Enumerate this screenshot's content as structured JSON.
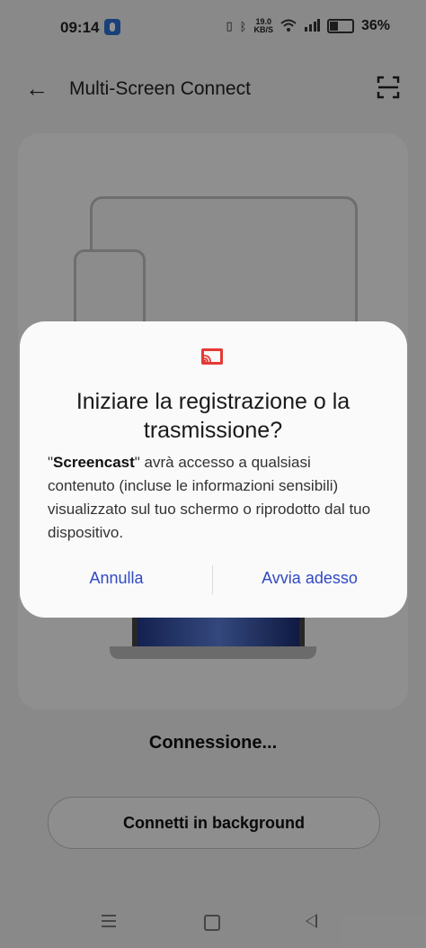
{
  "status_bar": {
    "time": "09:14",
    "speed_value": "19.0",
    "speed_unit": "KB/S",
    "battery": "36%"
  },
  "app_bar": {
    "title": "Multi-Screen Connect"
  },
  "main": {
    "connecting_text": "Connessione...",
    "background_button": "Connetti in background"
  },
  "dialog": {
    "title": "Iniziare la registrazione o la trasmissione?",
    "body_quote_open": "\"",
    "body_app_name": "Screencast",
    "body_rest": "\" avrà accesso a qualsiasi contenuto (incluse le informazioni sensibili) visualizzato sul tuo schermo o riprodotto dal tuo dispositivo.",
    "cancel": "Annulla",
    "confirm": "Avvia adesso"
  },
  "colors": {
    "accent": "#3149c4",
    "cast_icon": "#e53935"
  }
}
